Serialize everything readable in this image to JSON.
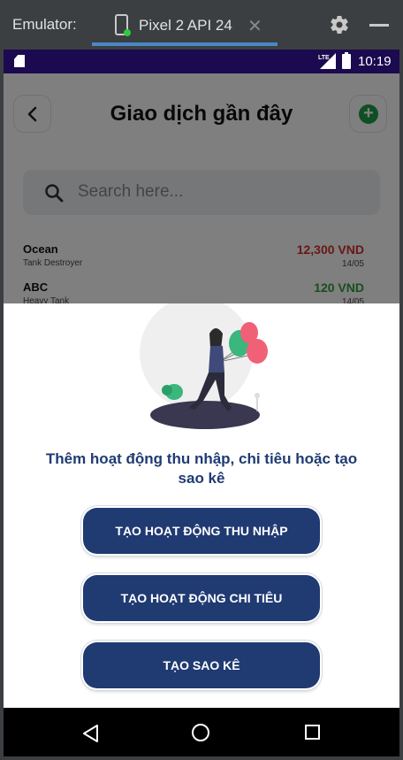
{
  "emulator": {
    "label": "Emulator:",
    "tab_label": "Pixel 2 API 24",
    "close_glyph": "✕",
    "icons": [
      "phone-device-icon",
      "gear-icon",
      "minimize-icon"
    ]
  },
  "status_bar": {
    "time": "10:19",
    "network": "LTE",
    "bg_color": "#1b0a4f"
  },
  "header": {
    "title": "Giao dịch gần đây",
    "back_icon": "chevron-left-icon",
    "add_icon": "plus-circle-icon",
    "add_color": "#1f9e47"
  },
  "search": {
    "placeholder": "Search here..."
  },
  "transactions": [
    {
      "name": "Ocean",
      "sub": "Tank Destroyer",
      "amount": "12,300 VND",
      "date": "14/05",
      "color": "#d32f2f"
    },
    {
      "name": "ABC",
      "sub": "Heavy Tank",
      "amount": "120 VND",
      "date": "14/05",
      "color": "#2e9e3a"
    }
  ],
  "sheet": {
    "message": "Thêm hoạt động thu nhập, chi tiêu hoặc tạo sao kê",
    "buttons": {
      "income": "TẠO HOẠT ĐỘNG THU NHẬP",
      "expense": "TẠO HOẠT ĐỘNG CHI TIÊU",
      "statement": "TẠO SAO KÊ"
    },
    "button_color": "#203a72",
    "text_color": "#1f3b73"
  }
}
